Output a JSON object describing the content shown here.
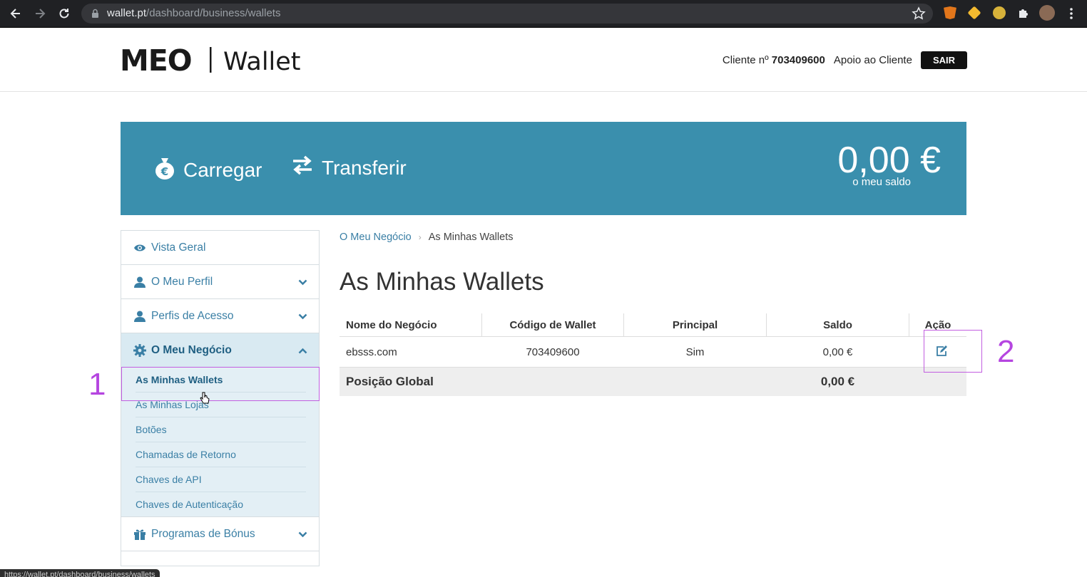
{
  "browser": {
    "url_host": "wallet.pt",
    "url_path": "/dashboard/business/wallets",
    "status_url": "https://wallet.pt/dashboard/business/wallets"
  },
  "header": {
    "logo_brand": "MEO",
    "logo_product": "Wallet",
    "client_label": "Cliente nº",
    "client_number": "703409600",
    "support_link": "Apoio ao Cliente",
    "logout_button": "SAIR"
  },
  "banner": {
    "color": "#3a8fad",
    "load_label": "Carregar",
    "transfer_label": "Transferir",
    "balance_value": "0,00 €",
    "balance_label": "o meu saldo"
  },
  "sidebar": {
    "items": [
      {
        "label": "Vista Geral",
        "icon": "eye-icon"
      },
      {
        "label": "O Meu Perfil",
        "icon": "user-icon"
      },
      {
        "label": "Perfis de Acesso",
        "icon": "users-icon"
      },
      {
        "label": "O Meu Negócio",
        "icon": "gear-icon"
      },
      {
        "label": "Programas de Bónus",
        "icon": "gift-icon"
      }
    ],
    "business_sub": [
      "As Minhas Wallets",
      "As Minhas Lojas",
      "Botões",
      "Chamadas de Retorno",
      "Chaves de API",
      "Chaves de Autenticação"
    ]
  },
  "main": {
    "breadcrumb": [
      "O Meu Negócio",
      "As Minhas Wallets"
    ],
    "title": "As Minhas Wallets",
    "table": {
      "headers": [
        "Nome do Negócio",
        "Código de Wallet",
        "Principal",
        "Saldo",
        "Ação"
      ],
      "rows": [
        {
          "name": "ebsss.com",
          "code": "703409600",
          "principal": "Sim",
          "balance": "0,00 €"
        }
      ],
      "total_label": "Posição Global",
      "total_value": "0,00 €"
    }
  },
  "annotations": {
    "first": "1",
    "second": "2",
    "color": "#b545e0"
  }
}
